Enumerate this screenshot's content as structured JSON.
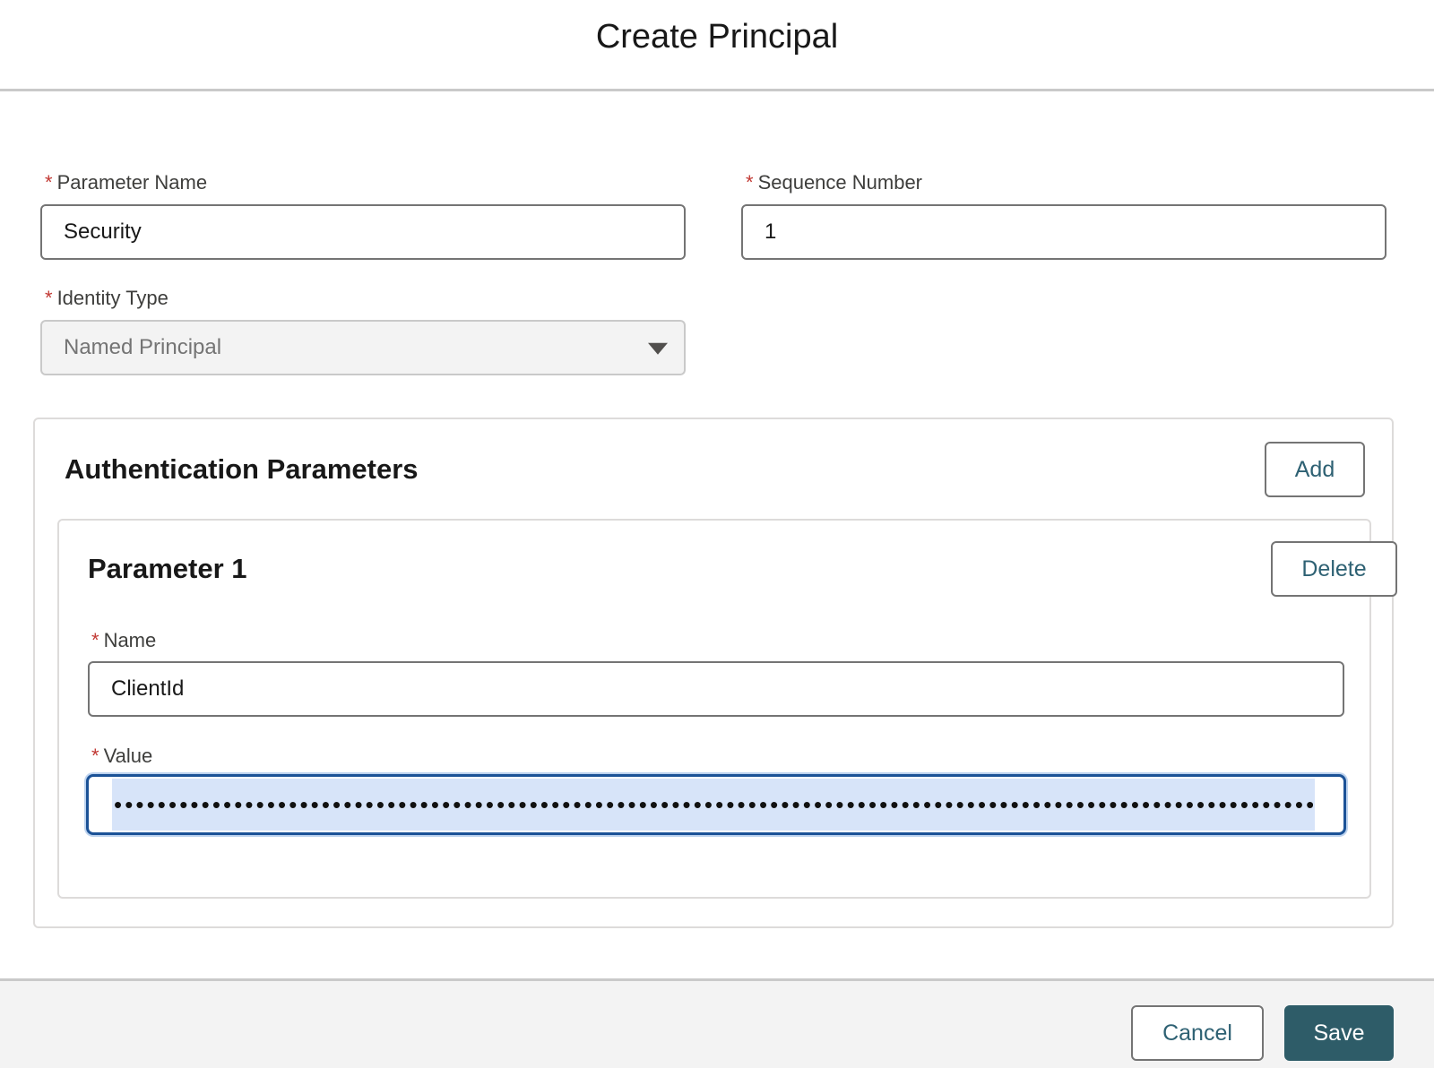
{
  "modal": {
    "title": "Create Principal"
  },
  "form": {
    "required_marker": "*",
    "parameter_name": {
      "label": "Parameter Name",
      "value": "Security"
    },
    "sequence_number": {
      "label": "Sequence Number",
      "value": "1"
    },
    "identity_type": {
      "label": "Identity Type",
      "value": "Named Principal",
      "disabled": true
    }
  },
  "auth_section": {
    "heading": "Authentication Parameters",
    "add_label": "Add",
    "parameters": [
      {
        "heading": "Parameter 1",
        "delete_label": "Delete",
        "name_label": "Name",
        "name_value": "ClientId",
        "value_label": "Value",
        "value_masked": "••••••••••••••••••••••••••••••••••••••••••••••••••••••••••••••••••••••••••••••••••••••••••••••••••••••••••••••••••••••••••••••••••••••••••••",
        "value_selected": true
      }
    ]
  },
  "footer": {
    "cancel_label": "Cancel",
    "save_label": "Save"
  },
  "colors": {
    "required": "#c23934",
    "brand_button": "#2e5c68",
    "focus_border": "#1b5297",
    "selection": "#d7e4f9"
  }
}
